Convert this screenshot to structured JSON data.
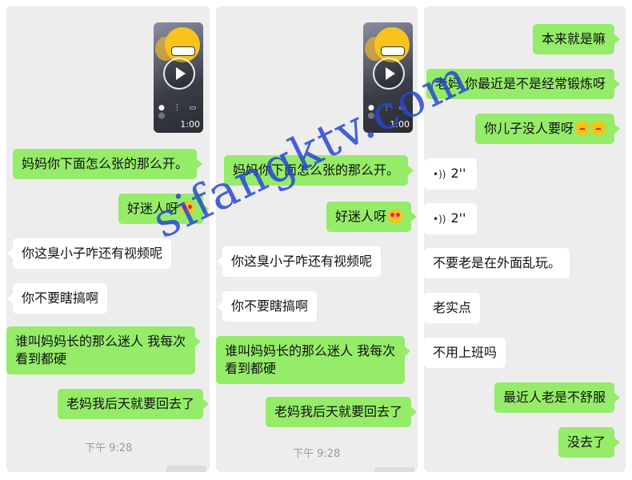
{
  "panels": [
    {
      "video_duration": "1:00",
      "messages": [
        {
          "text": "妈妈你下面怎么张的那么开。"
        },
        {
          "text": "好迷人呀"
        },
        {
          "text": "你这臭小子咋还有视频呢"
        },
        {
          "text": "你不要瞎搞啊"
        },
        {
          "text": "谁叫妈妈长的那么迷人  我每次看到都硬"
        },
        {
          "text": "老妈我后天就要回去了"
        }
      ],
      "timestamp": "下午 9:28"
    },
    {
      "video_duration": "1:00",
      "messages": [
        {
          "text": "妈妈你下面怎么张的那么开。"
        },
        {
          "text": "好迷人呀"
        },
        {
          "text": "你这臭小子咋还有视频呢"
        },
        {
          "text": "你不要瞎搞啊"
        },
        {
          "text": "谁叫妈妈长的那么迷人  我每次看到都硬"
        },
        {
          "text": "老妈我后天就要回去了"
        }
      ],
      "timestamp": "下午 9:28"
    },
    {
      "messages": [
        {
          "text": "本来就是嘛"
        },
        {
          "text": "老妈  你最近是不是经常锻炼呀"
        },
        {
          "text": "你儿子没人要呀"
        },
        {
          "text": "2''"
        },
        {
          "text": "2''"
        },
        {
          "text": "不要老是在外面乱玩。"
        },
        {
          "text": "老实点"
        },
        {
          "text": "不用上班吗"
        },
        {
          "text": "最近人老是不舒服"
        },
        {
          "text": "没去了"
        }
      ]
    }
  ],
  "watermark": "sifangktv.com",
  "colors": {
    "outgoing": "#95ec69",
    "incoming": "#ffffff",
    "background": "#ededed"
  }
}
